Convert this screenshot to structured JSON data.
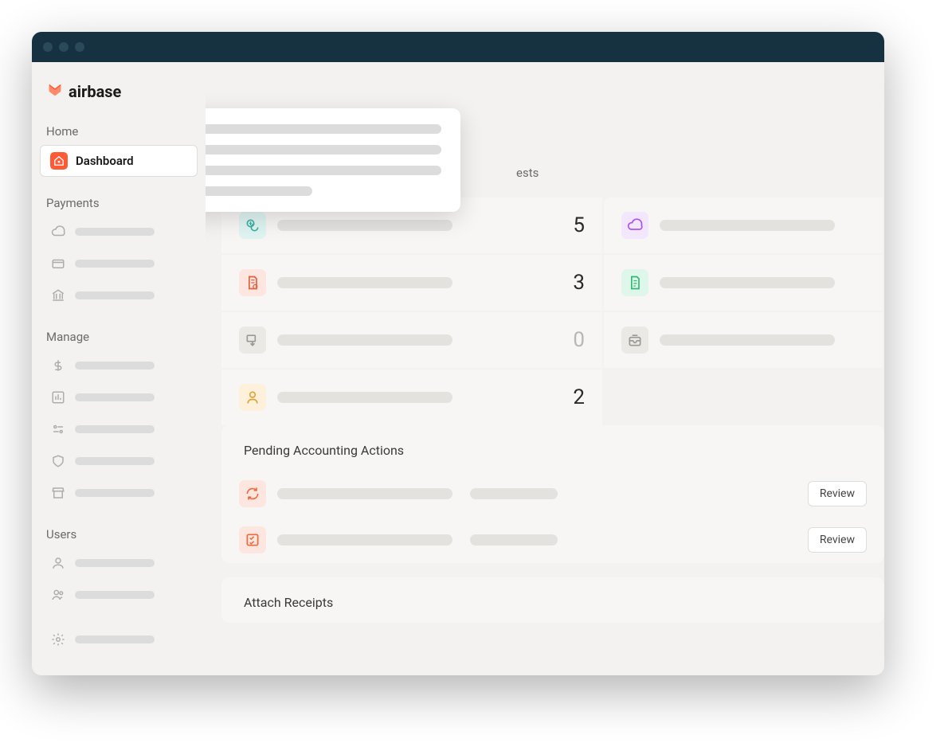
{
  "brand": {
    "name": "airbase"
  },
  "sidebar": {
    "sections": {
      "home": {
        "label": "Home",
        "dashboard_label": "Dashboard"
      },
      "payments": {
        "label": "Payments"
      },
      "manage": {
        "label": "Manage"
      },
      "users": {
        "label": "Users"
      }
    }
  },
  "content": {
    "pending_requests_partial": "ests",
    "counts": {
      "row0": 5,
      "row1": 3,
      "row2": 0,
      "row3": 2
    },
    "sections": {
      "accounting_title": "Pending Accounting Actions",
      "attach_receipts_title": "Attach Receipts"
    },
    "buttons": {
      "review": "Review"
    }
  }
}
